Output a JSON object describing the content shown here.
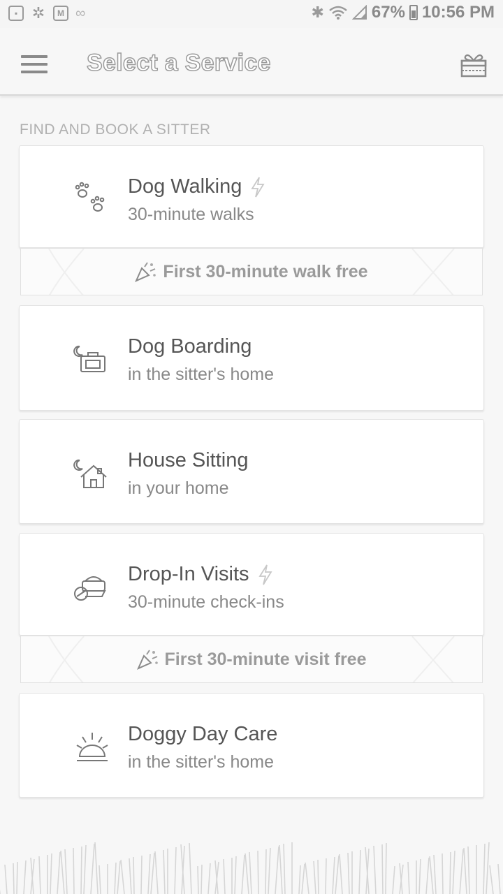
{
  "status_bar": {
    "battery": "67%",
    "time": "10:56 PM"
  },
  "app_bar": {
    "title": "Select a Service"
  },
  "section": {
    "label": "FIND AND BOOK A SITTER"
  },
  "services": [
    {
      "name": "Dog Walking",
      "subtitle": "30-minute walks",
      "icon": "paw-prints-icon",
      "instant": true,
      "promo": "First 30-minute walk free"
    },
    {
      "name": "Dog Boarding",
      "subtitle": "in the sitter's home",
      "icon": "moon-suitcase-icon",
      "instant": false
    },
    {
      "name": "House Sitting",
      "subtitle": "in your home",
      "icon": "moon-house-icon",
      "instant": false
    },
    {
      "name": "Drop-In Visits",
      "subtitle": "30-minute check-ins",
      "icon": "food-bowl-icon",
      "instant": true,
      "promo": "First 30-minute visit free"
    },
    {
      "name": "Doggy Day Care",
      "subtitle": "in the sitter's home",
      "icon": "sunrise-icon",
      "instant": false
    }
  ]
}
